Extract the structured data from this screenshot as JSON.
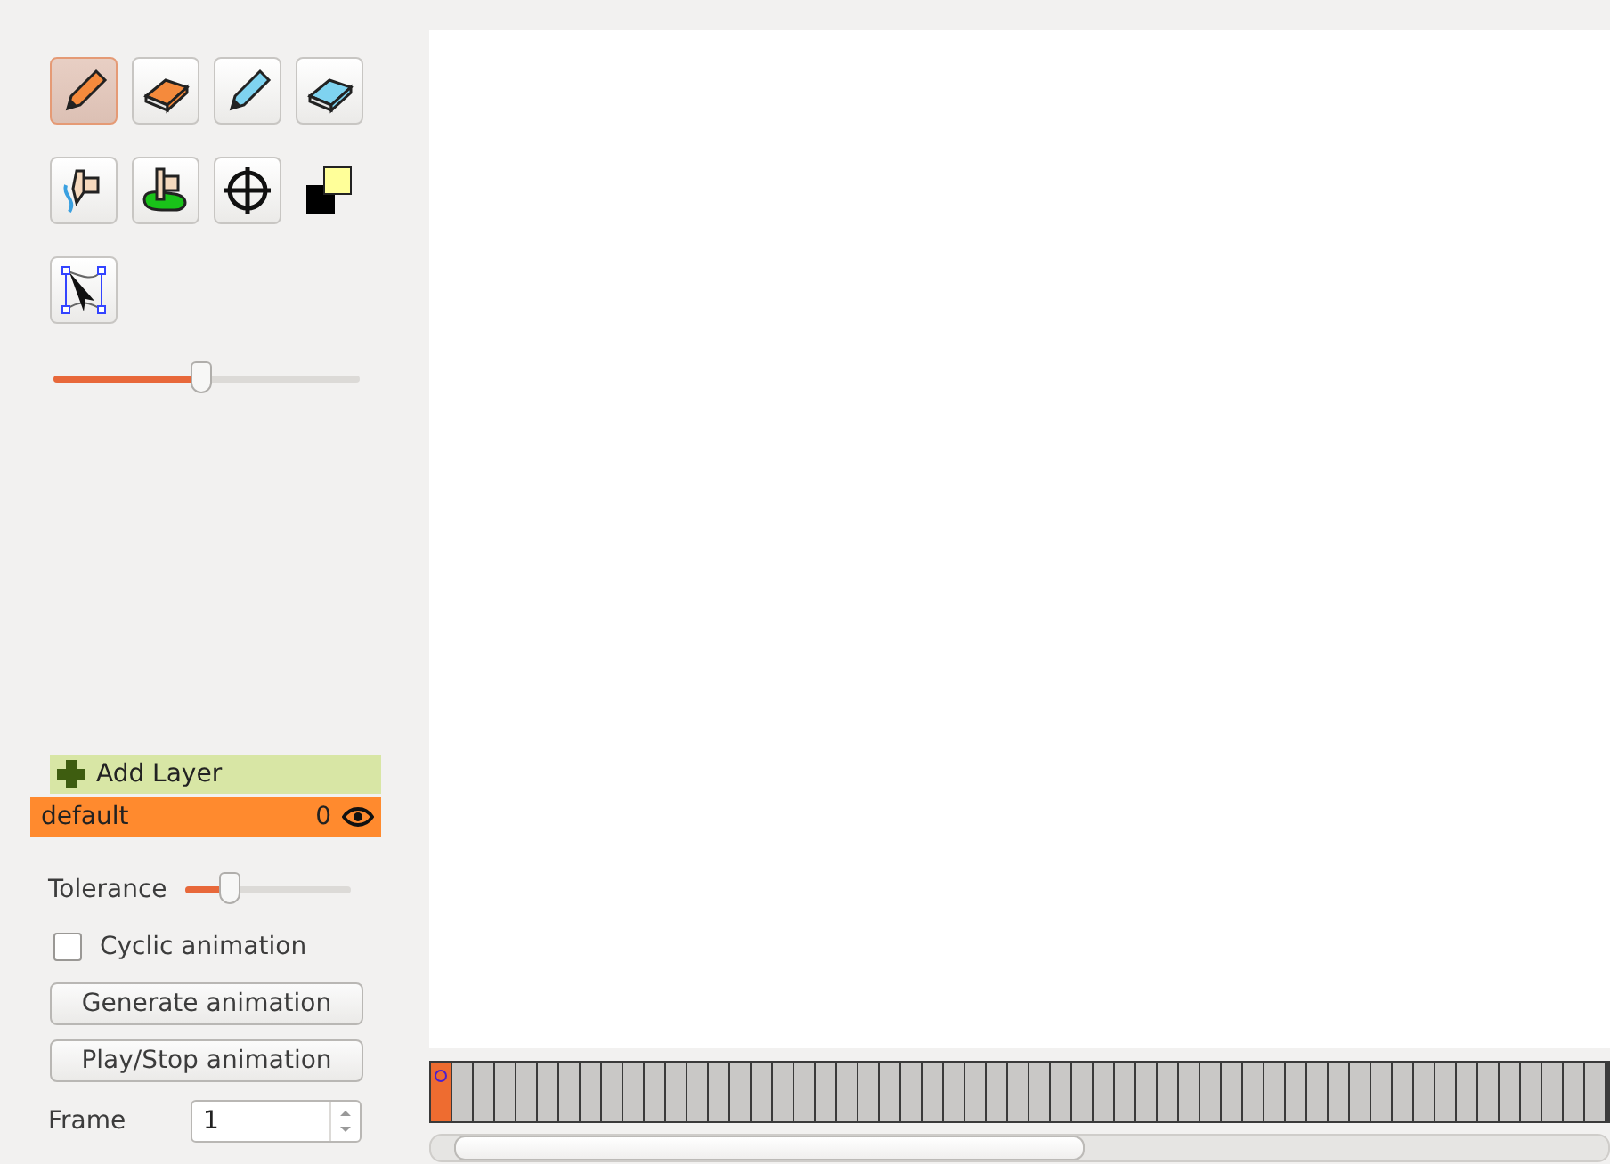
{
  "tools": [
    {
      "kind": "pencil",
      "selected": true
    },
    {
      "kind": "eraser",
      "selected": false
    },
    {
      "kind": "pencil-blue",
      "selected": false
    },
    {
      "kind": "eraser-blue",
      "selected": false
    },
    {
      "kind": "hand-curve",
      "selected": false
    },
    {
      "kind": "hand-fill",
      "selected": false
    },
    {
      "kind": "crosshair",
      "selected": false
    },
    {
      "kind": "colors",
      "selected": false
    },
    {
      "kind": "select",
      "selected": false
    }
  ],
  "brush_size": {
    "level": 0.48
  },
  "add_layer": {
    "label": "Add Layer"
  },
  "layers": [
    {
      "name": "default",
      "count": "0",
      "visible": true,
      "selected": true
    }
  ],
  "tolerance": {
    "label": "Tolerance",
    "level": 0.27
  },
  "cyclic": {
    "label": "Cyclic animation",
    "checked": false
  },
  "buttons": [
    "Generate animation",
    "Play/Stop animation"
  ],
  "frame": {
    "label": "Frame",
    "value": "1"
  },
  "timeline": {
    "frames": [
      {
        "selected": true,
        "keyframe": true
      },
      {
        "selected": false,
        "keyframe": false
      },
      {
        "selected": false,
        "keyframe": false
      },
      {
        "selected": false,
        "keyframe": false
      },
      {
        "selected": false,
        "keyframe": false
      },
      {
        "selected": false,
        "keyframe": false
      },
      {
        "selected": false,
        "keyframe": false
      },
      {
        "selected": false,
        "keyframe": false
      },
      {
        "selected": false,
        "keyframe": false
      },
      {
        "selected": false,
        "keyframe": false
      },
      {
        "selected": false,
        "keyframe": false
      },
      {
        "selected": false,
        "keyframe": false
      },
      {
        "selected": false,
        "keyframe": false
      },
      {
        "selected": false,
        "keyframe": false
      },
      {
        "selected": false,
        "keyframe": false
      },
      {
        "selected": false,
        "keyframe": false
      },
      {
        "selected": false,
        "keyframe": false
      },
      {
        "selected": false,
        "keyframe": false
      },
      {
        "selected": false,
        "keyframe": false
      },
      {
        "selected": false,
        "keyframe": false
      },
      {
        "selected": false,
        "keyframe": false
      },
      {
        "selected": false,
        "keyframe": false
      },
      {
        "selected": false,
        "keyframe": false
      },
      {
        "selected": false,
        "keyframe": false
      },
      {
        "selected": false,
        "keyframe": false
      },
      {
        "selected": false,
        "keyframe": false
      },
      {
        "selected": false,
        "keyframe": false
      },
      {
        "selected": false,
        "keyframe": false
      },
      {
        "selected": false,
        "keyframe": false
      },
      {
        "selected": false,
        "keyframe": false
      },
      {
        "selected": false,
        "keyframe": false
      },
      {
        "selected": false,
        "keyframe": false
      },
      {
        "selected": false,
        "keyframe": false
      },
      {
        "selected": false,
        "keyframe": false
      },
      {
        "selected": false,
        "keyframe": false
      },
      {
        "selected": false,
        "keyframe": false
      },
      {
        "selected": false,
        "keyframe": false
      },
      {
        "selected": false,
        "keyframe": false
      },
      {
        "selected": false,
        "keyframe": false
      },
      {
        "selected": false,
        "keyframe": false
      },
      {
        "selected": false,
        "keyframe": false
      },
      {
        "selected": false,
        "keyframe": false
      },
      {
        "selected": false,
        "keyframe": false
      },
      {
        "selected": false,
        "keyframe": false
      },
      {
        "selected": false,
        "keyframe": false
      },
      {
        "selected": false,
        "keyframe": false
      },
      {
        "selected": false,
        "keyframe": false
      },
      {
        "selected": false,
        "keyframe": false
      },
      {
        "selected": false,
        "keyframe": false
      },
      {
        "selected": false,
        "keyframe": false
      },
      {
        "selected": false,
        "keyframe": false
      },
      {
        "selected": false,
        "keyframe": false
      },
      {
        "selected": false,
        "keyframe": false
      },
      {
        "selected": false,
        "keyframe": false
      },
      {
        "selected": false,
        "keyframe": false
      }
    ]
  }
}
